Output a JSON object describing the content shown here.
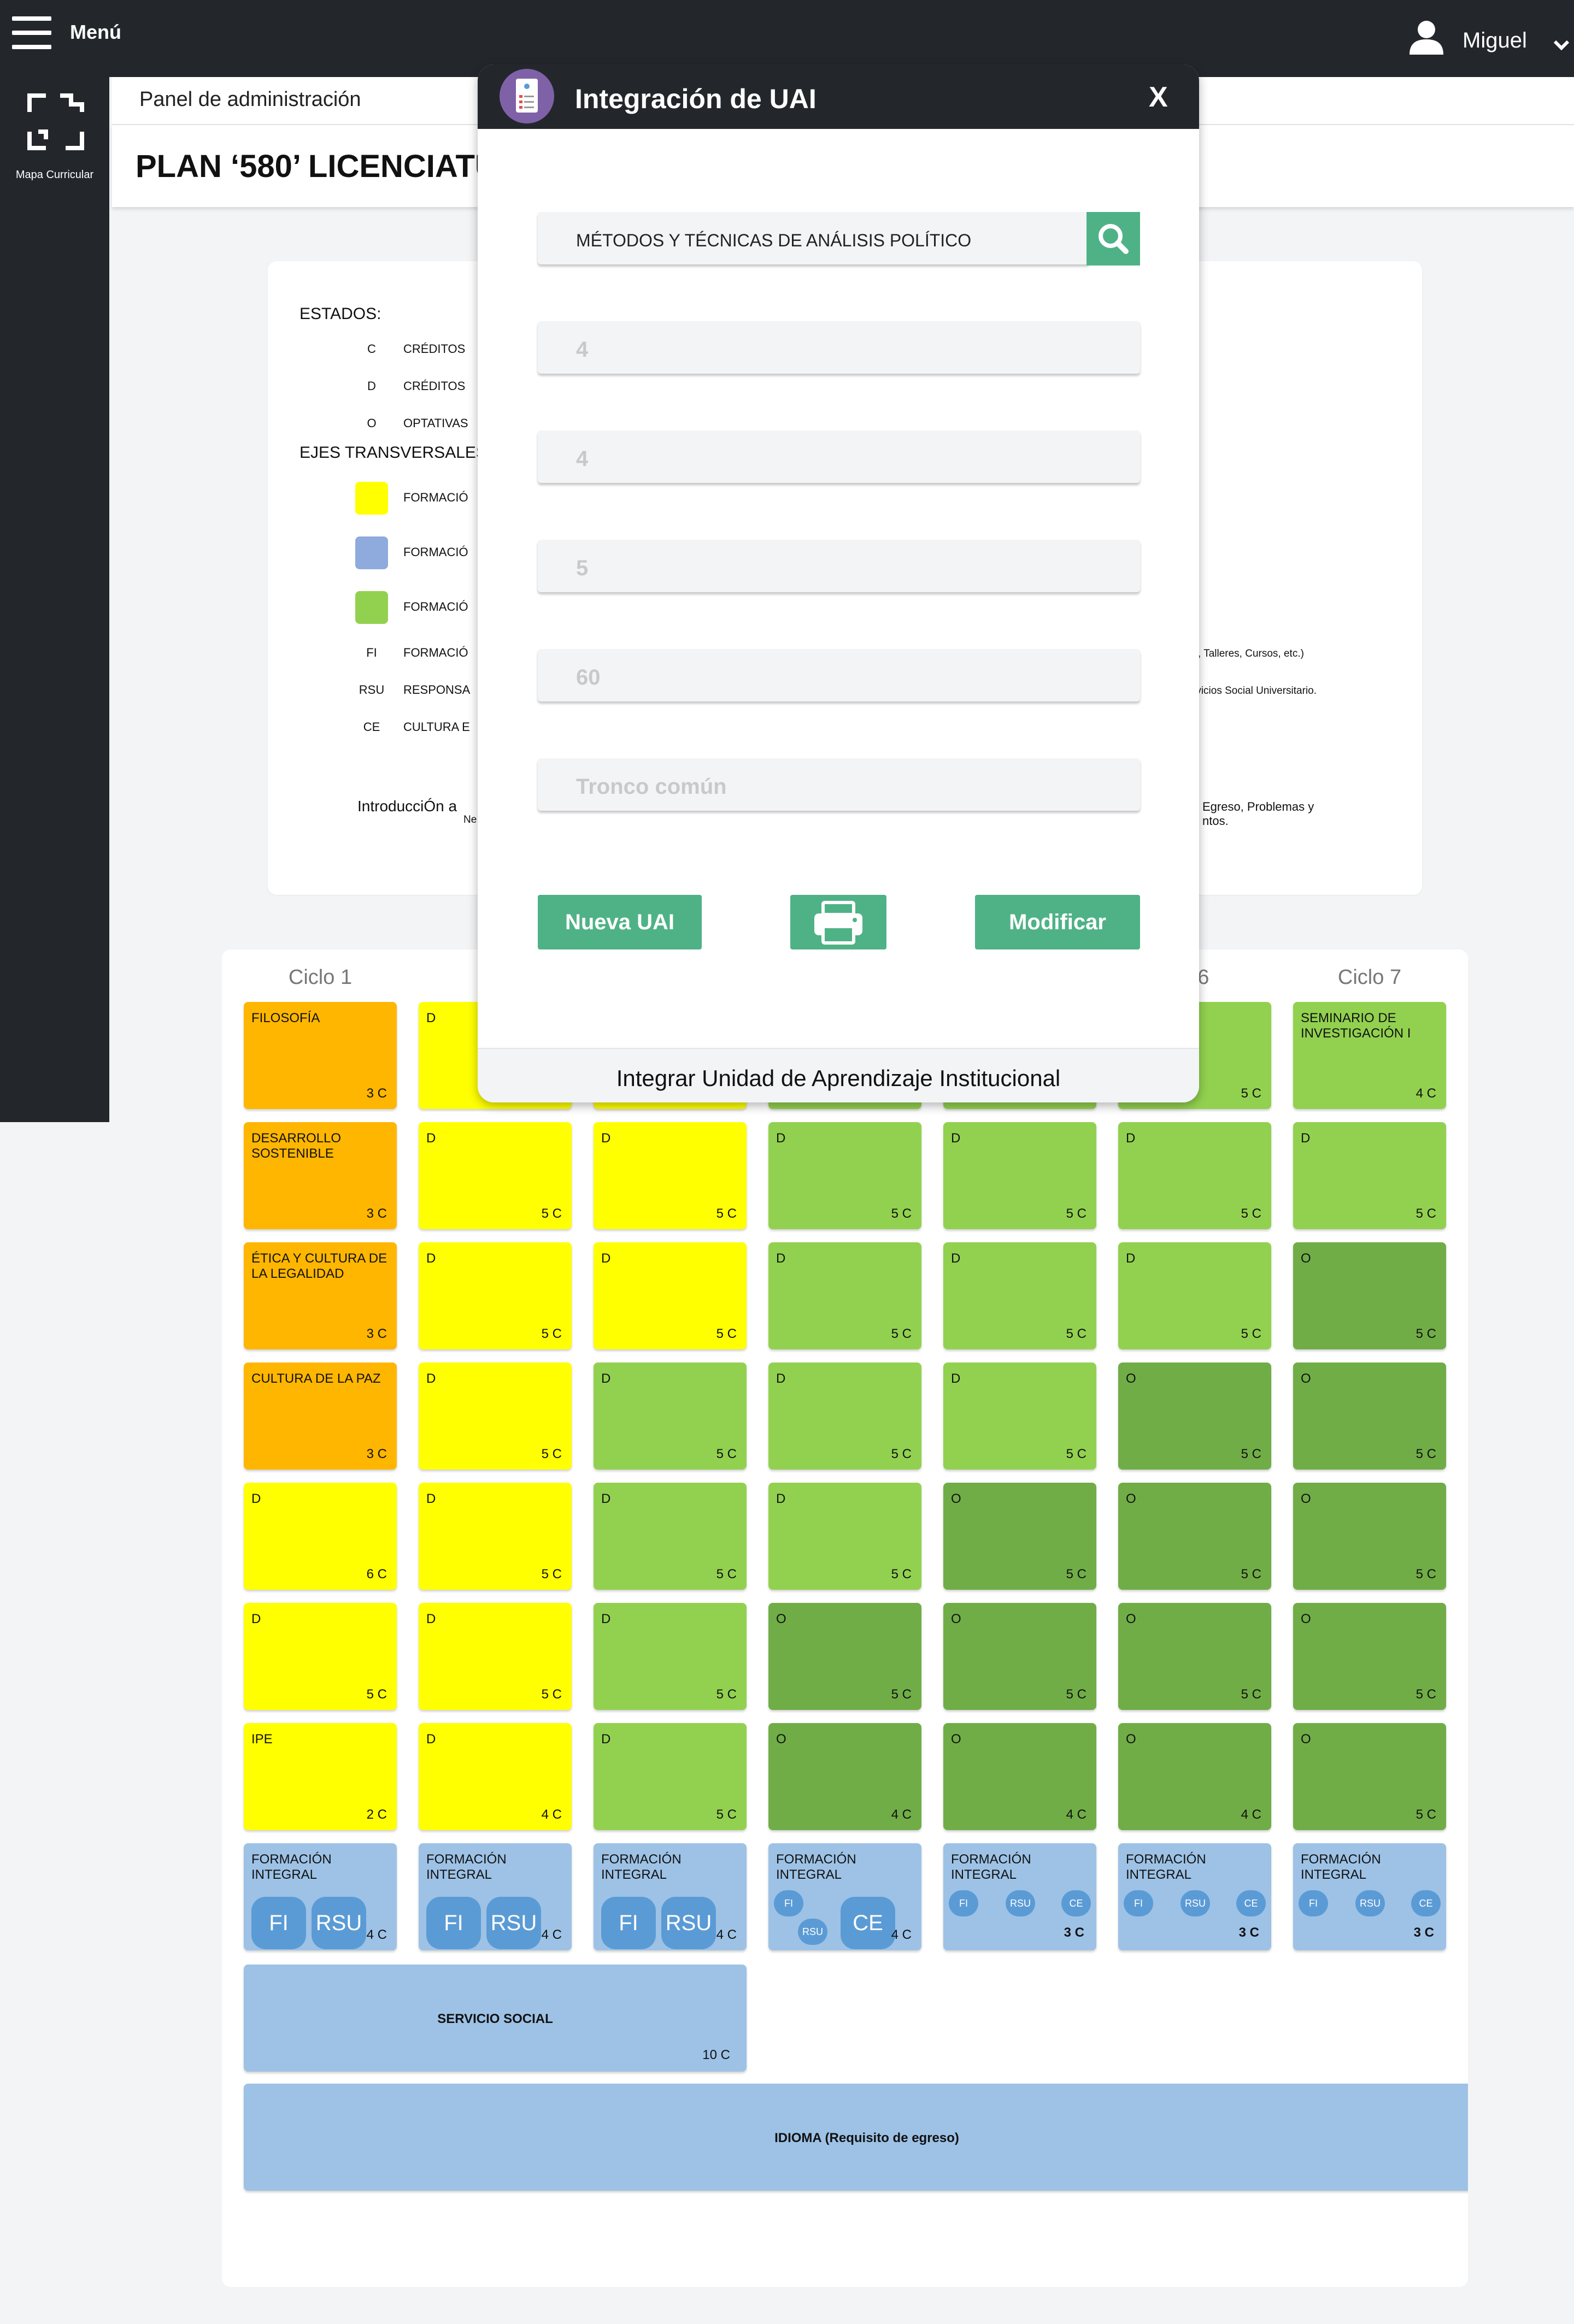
{
  "topbar": {
    "menu_label": "Menú",
    "user_name": "Miguel",
    "icons": [
      "menu-icon",
      "user-icon",
      "chevron-down-icon"
    ]
  },
  "sidebar": {
    "items": [
      {
        "label": "Mapa Curricular",
        "icon": "frame-icon"
      }
    ]
  },
  "admin_header": {
    "title": "Panel de administración"
  },
  "plan_header": {
    "title": "PLAN  ‘580’ LICENCIATU"
  },
  "legend": {
    "estados_title": "ESTADOS:",
    "estados": [
      {
        "code": "C",
        "desc": "CRÉDITOS"
      },
      {
        "code": "D",
        "desc": "CRÉDITOS"
      },
      {
        "code": "O",
        "desc": "OPTATIVAS"
      }
    ],
    "ejes_title": "EJES TRANSVERSALES",
    "ejes": [
      {
        "desc": "FORMACIÓ",
        "color": "#ffff00"
      },
      {
        "desc": "FORMACIÓ",
        "color": "#8faadc"
      },
      {
        "desc": "FORMACIÓ",
        "color": "#92d14f"
      }
    ],
    "codes": [
      {
        "code": "FI",
        "desc": "FORMACIÓ",
        "tail": ", Talleres, Cursos, etc.)"
      },
      {
        "code": "RSU",
        "desc": "RESPONSA",
        "tail": "rvicios Social Universitario."
      },
      {
        "code": "CE",
        "desc": "CULTURA E",
        "tail": ""
      }
    ],
    "intro": "IntroducciÓn a",
    "intro_line2": "Ne",
    "right_line1": "Egreso, Problemas y",
    "right_line2": "ntos."
  },
  "grid": {
    "cycles": [
      "Ciclo 1",
      "C",
      "",
      "",
      "",
      "o 6",
      "Ciclo 7"
    ],
    "cells": [
      [
        {
          "name": "FILOSOFÍA",
          "credits": "3 C",
          "color": "or"
        },
        {
          "name": "D",
          "credits": "",
          "color": "ye"
        },
        {
          "name": "",
          "credits": "",
          "color": "ye"
        },
        {
          "name": "",
          "credits": "",
          "color": "lg"
        },
        {
          "name": "",
          "credits": "",
          "color": "lg"
        },
        {
          "name": "",
          "credits": "5 C",
          "color": "lg"
        },
        {
          "name": "SEMINARIO DE INVESTIGACIÓN I",
          "credits": "4 C",
          "color": "lg"
        }
      ],
      [
        {
          "name": "DESARROLLO SOSTENIBLE",
          "credits": "3 C",
          "color": "or"
        },
        {
          "name": "D",
          "credits": "5 C",
          "color": "ye"
        },
        {
          "name": "D",
          "credits": "5 C",
          "color": "ye"
        },
        {
          "name": "D",
          "credits": "5 C",
          "color": "lg"
        },
        {
          "name": "D",
          "credits": "5 C",
          "color": "lg"
        },
        {
          "name": "D",
          "credits": "5 C",
          "color": "lg"
        },
        {
          "name": "D",
          "credits": "5 C",
          "color": "lg"
        }
      ],
      [
        {
          "name": "ÉTICA Y CULTURA DE LA LEGALIDAD",
          "credits": "3 C",
          "color": "or"
        },
        {
          "name": "D",
          "credits": "5 C",
          "color": "ye"
        },
        {
          "name": "D",
          "credits": "5 C",
          "color": "ye"
        },
        {
          "name": "D",
          "credits": "5 C",
          "color": "lg"
        },
        {
          "name": "D",
          "credits": "5 C",
          "color": "lg"
        },
        {
          "name": "D",
          "credits": "5 C",
          "color": "lg"
        },
        {
          "name": "O",
          "credits": "5 C",
          "color": "dg"
        }
      ],
      [
        {
          "name": "CULTURA DE LA PAZ",
          "credits": "3 C",
          "color": "or"
        },
        {
          "name": "D",
          "credits": "5 C",
          "color": "ye"
        },
        {
          "name": "D",
          "credits": "5 C",
          "color": "lg"
        },
        {
          "name": "D",
          "credits": "5 C",
          "color": "lg"
        },
        {
          "name": "D",
          "credits": "5 C",
          "color": "lg"
        },
        {
          "name": "O",
          "credits": "5 C",
          "color": "dg"
        },
        {
          "name": "O",
          "credits": "5 C",
          "color": "dg"
        }
      ],
      [
        {
          "name": "D",
          "credits": "6 C",
          "color": "ye"
        },
        {
          "name": "D",
          "credits": "5 C",
          "color": "ye"
        },
        {
          "name": "D",
          "credits": "5 C",
          "color": "lg"
        },
        {
          "name": "D",
          "credits": "5 C",
          "color": "lg"
        },
        {
          "name": "O",
          "credits": "5 C",
          "color": "dg"
        },
        {
          "name": "O",
          "credits": "5 C",
          "color": "dg"
        },
        {
          "name": "O",
          "credits": "5 C",
          "color": "dg"
        }
      ],
      [
        {
          "name": "D",
          "credits": "5 C",
          "color": "ye"
        },
        {
          "name": "D",
          "credits": "5 C",
          "color": "ye"
        },
        {
          "name": "D",
          "credits": "5 C",
          "color": "lg"
        },
        {
          "name": "O",
          "credits": "5 C",
          "color": "dg"
        },
        {
          "name": "O",
          "credits": "5 C",
          "color": "dg"
        },
        {
          "name": "O",
          "credits": "5 C",
          "color": "dg"
        },
        {
          "name": "O",
          "credits": "5 C",
          "color": "dg"
        }
      ],
      [
        {
          "name": "IPE",
          "credits": "2 C",
          "color": "ye"
        },
        {
          "name": "D",
          "credits": "4 C",
          "color": "ye"
        },
        {
          "name": "D",
          "credits": "5 C",
          "color": "lg"
        },
        {
          "name": "O",
          "credits": "4 C",
          "color": "dg"
        },
        {
          "name": "O",
          "credits": "4 C",
          "color": "dg"
        },
        {
          "name": "O",
          "credits": "4 C",
          "color": "dg"
        },
        {
          "name": "O",
          "credits": "5 C",
          "color": "dg"
        }
      ]
    ],
    "fi_row": [
      {
        "name": "FORMACIÓN INTEGRAL",
        "credits": "4 C",
        "style": "big",
        "pills": [
          "FI",
          "RSU"
        ]
      },
      {
        "name": "FORMACIÓN INTEGRAL",
        "credits": "4 C",
        "style": "big",
        "pills": [
          "FI",
          "RSU"
        ]
      },
      {
        "name": "FORMACIÓN INTEGRAL",
        "credits": "4 C",
        "style": "big",
        "pills": [
          "FI",
          "RSU"
        ]
      },
      {
        "name": "FORMACIÓN INTEGRAL",
        "credits": "4 C",
        "style": "mixed",
        "pills": [
          "FI",
          "RSU",
          "CE"
        ]
      },
      {
        "name": "FORMACIÓN INTEGRAL",
        "credits": "3 C",
        "style": "small",
        "pills": [
          "FI",
          "RSU",
          "CE"
        ]
      },
      {
        "name": "FORMACIÓN INTEGRAL",
        "credits": "3 C",
        "style": "small",
        "pills": [
          "FI",
          "RSU",
          "CE"
        ]
      },
      {
        "name": "FORMACIÓN INTEGRAL",
        "credits": "3 C",
        "style": "small",
        "pills": [
          "FI",
          "RSU",
          "CE"
        ]
      }
    ],
    "servicio_social": {
      "name": "SERVICIO SOCIAL",
      "credits": "10 C"
    },
    "idioma": {
      "name": "IDIOMA (Requisito de egreso)"
    }
  },
  "modal": {
    "title": "Integración de UAI",
    "close_label": "X",
    "avatar_icon": "document-user-icon",
    "search_value": "MÉTODOS Y TÉCNICAS DE ANÁLISIS POLÍTICO",
    "fields": [
      "4",
      "4",
      "5",
      "60",
      "Tronco común"
    ],
    "buttons": {
      "new": "Nueva UAI",
      "print_icon": "printer-icon",
      "modify": "Modificar"
    },
    "footer": "Integrar Unidad de Aprendizaje Institucional"
  },
  "colors": {
    "dark": "#23272c",
    "orange": "#ffb600",
    "yellow": "#ffff00",
    "light_green": "#92d14f",
    "dark_green": "#70ad47",
    "blue": "#9dc2e6",
    "pill_blue": "#5b9bd5",
    "button_green": "#4fb286"
  }
}
